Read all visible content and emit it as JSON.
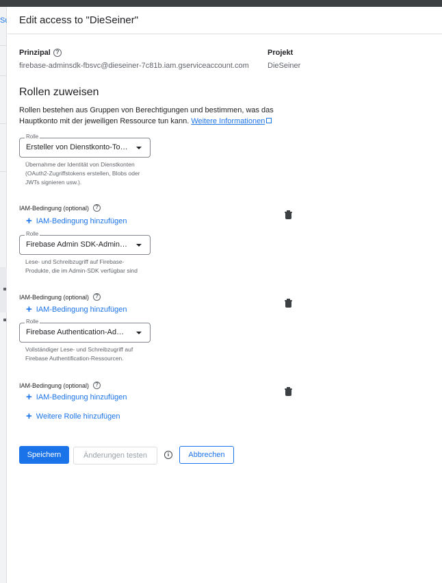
{
  "backdrop": {
    "link_fragment": "Su"
  },
  "dialog": {
    "title": "Edit access to \"DieSeiner\""
  },
  "principal": {
    "label": "Prinzipal",
    "value": "firebase-adminsdk-fbsvc@dieseiner-7c81b.iam.gserviceaccount.com"
  },
  "project": {
    "label": "Projekt",
    "value": "DieSeiner"
  },
  "roles_section": {
    "title": "Rollen zuweisen",
    "intro": "Rollen bestehen aus Gruppen von Berechtigungen und bestimmen, was das Hauptkonto mit der jeweiligen Ressource tun kann.",
    "learn_more": "Weitere Informationen"
  },
  "roles": [
    {
      "legend": "Rolle",
      "value": "Ersteller von Dienstkonto-Token",
      "description": "Übernahme der Identität von Dienstkonten (OAuth2-Zugriffstokens erstellen, Blobs oder JWTs signieren usw.).",
      "condition_label": "IAM-Bedingung (optional)",
      "add_condition": "IAM-Bedingung hinzufügen"
    },
    {
      "legend": "Rolle",
      "value": "Firebase Admin SDK-Administrator",
      "description": "Lese- und Schreibzugriff auf Firebase-Produkte, die im Admin-SDK verfügbar sind",
      "condition_label": "IAM-Bedingung (optional)",
      "add_condition": "IAM-Bedingung hinzufügen"
    },
    {
      "legend": "Rolle",
      "value": "Firebase Authentication-Administrator",
      "description": "Vollständiger Lese- und Schreibzugriff auf Firebase Authentification-Ressourcen.",
      "condition_label": "IAM-Bedingung (optional)",
      "add_condition": "IAM-Bedingung hinzufügen"
    }
  ],
  "add_role": "Weitere Rolle hinzufügen",
  "actions": {
    "save": "Speichern",
    "test": "Änderungen testen",
    "cancel": "Abbrechen"
  },
  "colors": {
    "accent": "#1a73e8",
    "disabled_text": "#9aa0a6",
    "border": "#dadce0"
  },
  "icons": [
    "help-icon",
    "external-link-icon",
    "trash-icon",
    "plus-icon",
    "caret-down-icon",
    "info-icon"
  ]
}
